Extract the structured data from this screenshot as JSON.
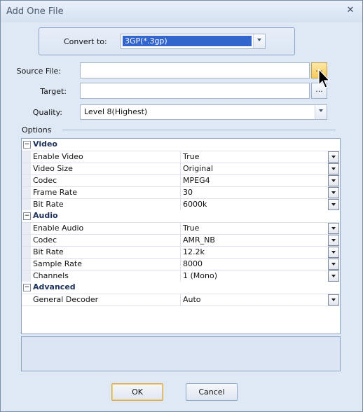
{
  "window": {
    "title": "Add One File",
    "close_glyph": "✕"
  },
  "convert": {
    "label": "Convert to:",
    "value": "3GP(*.3gp)"
  },
  "source": {
    "label": "Source File:",
    "value": "",
    "browse": "..."
  },
  "target": {
    "label": "Target:",
    "value": "",
    "browse": "..."
  },
  "quality": {
    "label": "Quality:",
    "value": "Level 8(Highest)"
  },
  "options_label": "Options",
  "categories": [
    {
      "name": "Video",
      "toggle": "−",
      "props": [
        {
          "name": "Enable Video",
          "value": "True"
        },
        {
          "name": "Video Size",
          "value": "Original"
        },
        {
          "name": "Codec",
          "value": "MPEG4"
        },
        {
          "name": "Frame Rate",
          "value": "30"
        },
        {
          "name": "Bit Rate",
          "value": "6000k"
        }
      ]
    },
    {
      "name": "Audio",
      "toggle": "−",
      "props": [
        {
          "name": "Enable Audio",
          "value": "True"
        },
        {
          "name": "Codec",
          "value": "AMR_NB"
        },
        {
          "name": "Bit Rate",
          "value": "12.2k"
        },
        {
          "name": "Sample Rate",
          "value": "8000"
        },
        {
          "name": "Channels",
          "value": "1 (Mono)"
        }
      ]
    },
    {
      "name": "Advanced",
      "toggle": "−",
      "props": [
        {
          "name": "General Decoder",
          "value": "Auto"
        }
      ]
    }
  ],
  "buttons": {
    "ok": "OK",
    "cancel": "Cancel"
  },
  "icons": {
    "browse": "ellipsis-icon",
    "dropdown": "chevron-down-icon",
    "cursor": "mouse-pointer-icon",
    "close": "close-icon"
  }
}
